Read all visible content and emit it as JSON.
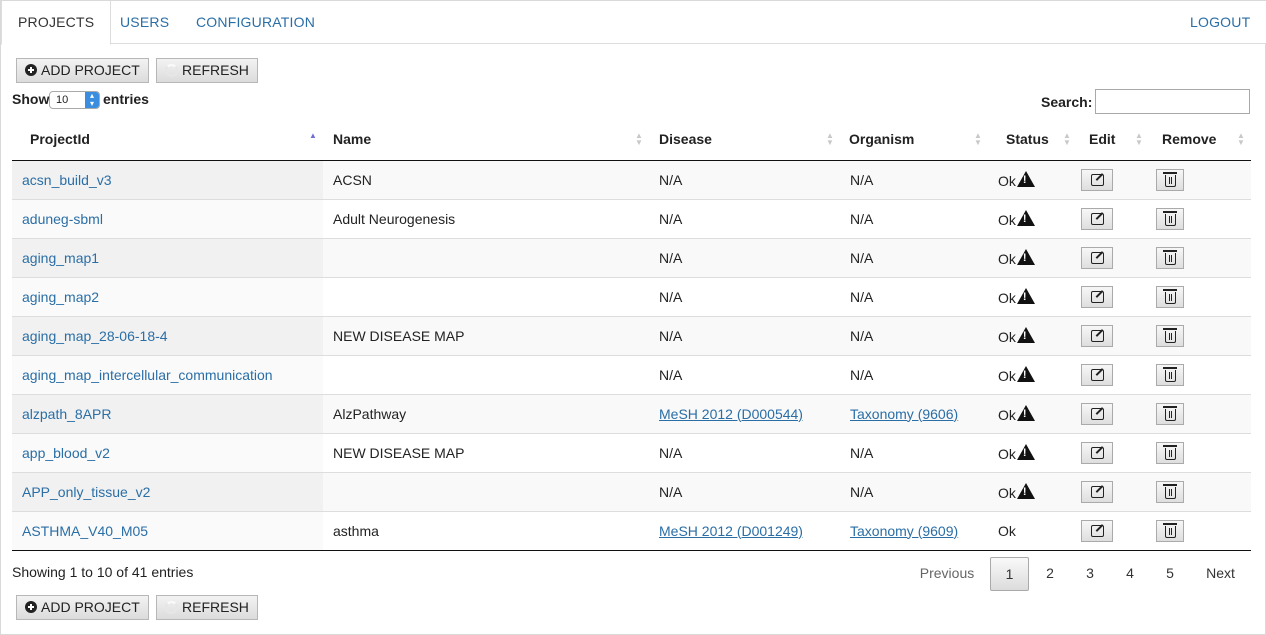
{
  "tabs": [
    {
      "label": "PROJECTS",
      "active": true
    },
    {
      "label": "USERS",
      "active": false
    },
    {
      "label": "CONFIGURATION",
      "active": false
    }
  ],
  "logout": "LOGOUT",
  "toolbar": {
    "add_project": "ADD PROJECT",
    "refresh": "REFRESH"
  },
  "length": {
    "show": "Show",
    "value": "10",
    "entries": "entries"
  },
  "search": {
    "label": "Search:",
    "value": ""
  },
  "columns": [
    "ProjectId",
    "Name",
    "Disease",
    "Organism",
    "Status",
    "Edit",
    "Remove"
  ],
  "rows": [
    {
      "id": "acsn_build_v3",
      "name": "ACSN",
      "disease": "N/A",
      "organism": "N/A",
      "status": "Ok",
      "warn": true
    },
    {
      "id": "aduneg-sbml",
      "name": "Adult Neurogenesis",
      "disease": "N/A",
      "organism": "N/A",
      "status": "Ok",
      "warn": true
    },
    {
      "id": "aging_map1",
      "name": "",
      "disease": "N/A",
      "organism": "N/A",
      "status": "Ok",
      "warn": true
    },
    {
      "id": "aging_map2",
      "name": "",
      "disease": "N/A",
      "organism": "N/A",
      "status": "Ok",
      "warn": true
    },
    {
      "id": "aging_map_28-06-18-4",
      "name": "NEW DISEASE MAP",
      "disease": "N/A",
      "organism": "N/A",
      "status": "Ok",
      "warn": true
    },
    {
      "id": "aging_map_intercellular_communication",
      "name": "",
      "disease": "N/A",
      "organism": "N/A",
      "status": "Ok",
      "warn": true
    },
    {
      "id": "alzpath_8APR",
      "name": "AlzPathway",
      "disease": "MeSH 2012 (D000544)",
      "organism": "Taxonomy (9606)",
      "status": "Ok",
      "warn": true
    },
    {
      "id": "app_blood_v2",
      "name": "NEW DISEASE MAP",
      "disease": "N/A",
      "organism": "N/A",
      "status": "Ok",
      "warn": true
    },
    {
      "id": "APP_only_tissue_v2",
      "name": "",
      "disease": "N/A",
      "organism": "N/A",
      "status": "Ok",
      "warn": true
    },
    {
      "id": "ASTHMA_V40_M05",
      "name": "asthma",
      "disease": "MeSH 2012 (D001249)",
      "organism": "Taxonomy (9609)",
      "status": "Ok",
      "warn": false
    }
  ],
  "info": "Showing 1 to 10 of 41 entries",
  "pagination": {
    "previous": "Previous",
    "pages": [
      "1",
      "2",
      "3",
      "4",
      "5"
    ],
    "current": "1",
    "next": "Next"
  }
}
